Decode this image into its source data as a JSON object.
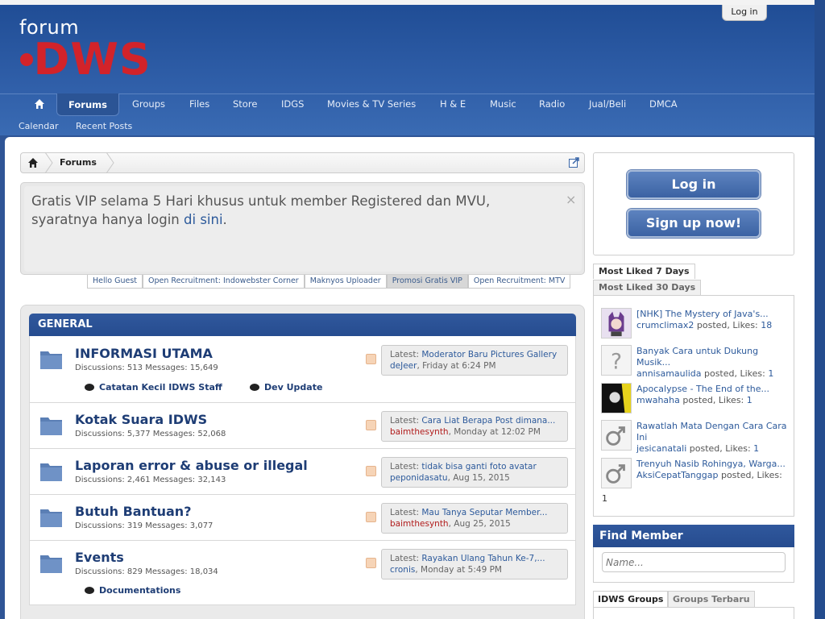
{
  "header": {
    "logo_forum": "forum",
    "logo_i": "i",
    "logo_dws": "DWS",
    "login_tab": "Log in"
  },
  "nav": {
    "active": "Forums",
    "items": [
      "Groups",
      "Files",
      "Store",
      "IDGS",
      "Movies & TV Series",
      "H & E",
      "Music",
      "Radio",
      "Jual/Beli",
      "DMCA"
    ],
    "sub_items": [
      "Calendar",
      "Recent Posts"
    ]
  },
  "breadcrumb": {
    "current": "Forums"
  },
  "notice": {
    "text": "Gratis VIP selama 5 Hari khusus untuk member Registered dan MVU, syaratnya hanya login ",
    "link": "di sini",
    "suffix": ".",
    "close": "×"
  },
  "notice_tabs": [
    "Hello Guest",
    "Open Recruitment: Indowebster Corner",
    "Maknyos Uploader",
    "Promosi Gratis VIP",
    "Open Recruitment: MTV"
  ],
  "category": {
    "title": "GENERAL"
  },
  "forums": [
    {
      "title": "INFORMASI UTAMA",
      "stats": "Discussions: 513 Messages: 15,649",
      "latest_label": "Latest:",
      "latest_title": "Moderator Baru Pictures Gallery",
      "latest_user": "deJeer",
      "latest_date": ", Friday at 6:24 PM",
      "user_red": false,
      "subforums": [
        "Catatan Kecil IDWS Staff",
        "Dev Update"
      ]
    },
    {
      "title": "Kotak Suara IDWS",
      "stats": "Discussions: 5,377 Messages: 52,068",
      "latest_label": "Latest:",
      "latest_title": "Cara Liat Berapa Post dimana...",
      "latest_user": "baimthesynth",
      "latest_date": ", Monday at 12:02 PM",
      "user_red": true,
      "subforums": []
    },
    {
      "title": "Laporan error & abuse or illegal",
      "stats": "Discussions: 2,461 Messages: 32,143",
      "latest_label": "Latest:",
      "latest_title": "tidak bisa ganti foto avatar",
      "latest_user": "peponidasatu",
      "latest_date": ", Aug 15, 2015",
      "user_red": false,
      "subforums": []
    },
    {
      "title": "Butuh Bantuan?",
      "stats": "Discussions: 319 Messages: 3,077",
      "latest_label": "Latest:",
      "latest_title": "Mau Tanya Seputar Member...",
      "latest_user": "baimthesynth",
      "latest_date": ", Aug 25, 2015",
      "user_red": true,
      "subforums": []
    },
    {
      "title": "Events",
      "stats": "Discussions: 829 Messages: 18,034",
      "latest_label": "Latest:",
      "latest_title": "Rayakan Ulang Tahun Ke-7,...",
      "latest_user": "cronis",
      "latest_date": ", Monday at 5:49 PM",
      "user_red": false,
      "subforums": [
        "Documentations"
      ]
    }
  ],
  "sidebar": {
    "login_button": "Log in",
    "signup_button": "Sign up now!",
    "likes_tab_active": "Most Liked 7 Days",
    "likes_tab_inactive": "Most Liked 30 Days",
    "liked": [
      {
        "title": "[NHK] The Mystery of Java's...",
        "user": "crumclimax2",
        "meta": " posted, Likes: ",
        "likes": "18",
        "avatar": "anime-avatar"
      },
      {
        "title": "Banyak Cara untuk Dukung Musik...",
        "user": "annisamaulida",
        "meta": " posted, Likes: ",
        "likes": "1",
        "avatar": "question-avatar"
      },
      {
        "title": "Apocalypse - The End of the...",
        "user": "mwahaha",
        "meta": " posted, Likes: ",
        "likes": "1",
        "avatar": "dark-avatar"
      },
      {
        "title": "Rawatlah Mata Dengan Cara Cara Ini",
        "user": "jesicanatali",
        "meta": " posted, Likes: ",
        "likes": "1",
        "avatar": "male-avatar"
      },
      {
        "title": "Trenyuh Nasib Rohingya, Warga...",
        "user": "AksiCepatTanggap",
        "meta": " posted, Likes: ",
        "likes": "1",
        "avatar": "male-avatar"
      }
    ],
    "find_member_title": "Find Member",
    "find_member_placeholder": "Name...",
    "groups_tab_active": "IDWS Groups",
    "groups_tab_inactive": "Groups Terbaru"
  }
}
